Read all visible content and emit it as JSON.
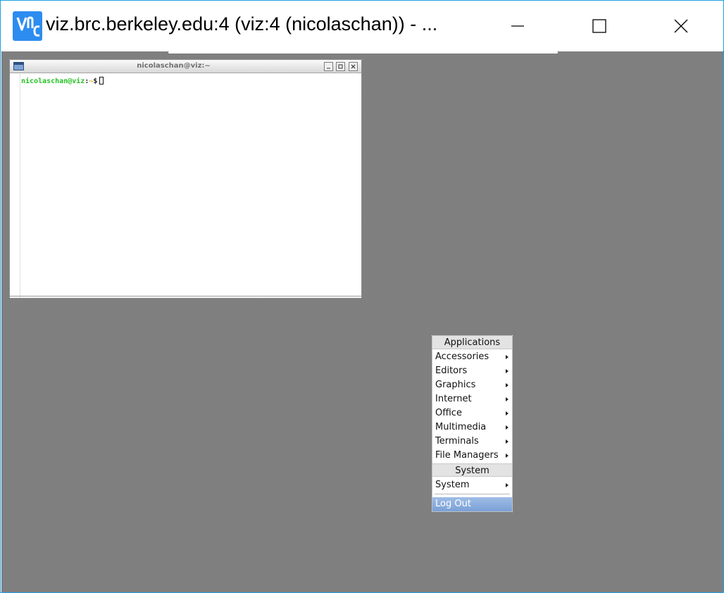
{
  "window": {
    "title": "viz.brc.berkeley.edu:4 (viz:4 (nicolaschan)) - ...",
    "app_icon": "vnc-viewer-icon",
    "controls": [
      "minimize-icon",
      "maximize-icon",
      "close-icon"
    ]
  },
  "terminal": {
    "title": "nicolaschan@viz:~",
    "prompt_user": "nicolaschan@viz",
    "prompt_colon": ":",
    "prompt_path": "~",
    "prompt_symbol": "$",
    "colors": {
      "user": "#22c222",
      "path": "#d5b300"
    }
  },
  "root_menu": {
    "applications_header": "Applications",
    "items": [
      {
        "label": "Accessories",
        "submenu": true
      },
      {
        "label": "Editors",
        "submenu": true
      },
      {
        "label": "Graphics",
        "submenu": true
      },
      {
        "label": "Internet",
        "submenu": true
      },
      {
        "label": "Office",
        "submenu": true
      },
      {
        "label": "Multimedia",
        "submenu": true
      },
      {
        "label": "Terminals",
        "submenu": true
      },
      {
        "label": "File Managers",
        "submenu": true
      }
    ],
    "system_header": "System",
    "system_items": [
      {
        "label": "System",
        "submenu": true
      }
    ],
    "logout_label": "Log Out",
    "highlight_color": "#7aa0d6"
  }
}
